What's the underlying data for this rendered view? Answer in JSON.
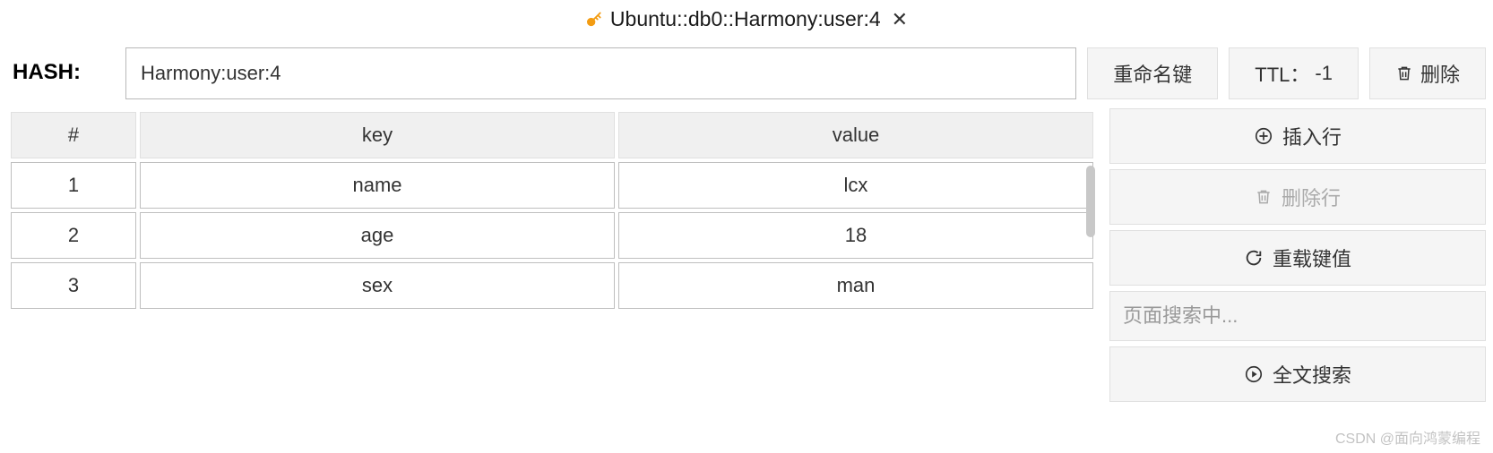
{
  "tab": {
    "title": "Ubuntu::db0::Harmony:user:4"
  },
  "header": {
    "type_label": "HASH:",
    "key_value": "Harmony:user:4",
    "rename_label": "重命名键",
    "ttl_label": "TTL：",
    "ttl_value": "-1",
    "delete_label": "删除"
  },
  "table": {
    "headers": {
      "index": "#",
      "key": "key",
      "value": "value"
    },
    "rows": [
      {
        "idx": "1",
        "key": "name",
        "value": "lcx"
      },
      {
        "idx": "2",
        "key": "age",
        "value": "18"
      },
      {
        "idx": "3",
        "key": "sex",
        "value": "man"
      }
    ]
  },
  "side": {
    "insert_row": "插入行",
    "delete_row": "删除行",
    "reload": "重载键值",
    "search_placeholder": "页面搜索中...",
    "fulltext_search": "全文搜索"
  },
  "watermark": "CSDN @面向鸿蒙编程"
}
